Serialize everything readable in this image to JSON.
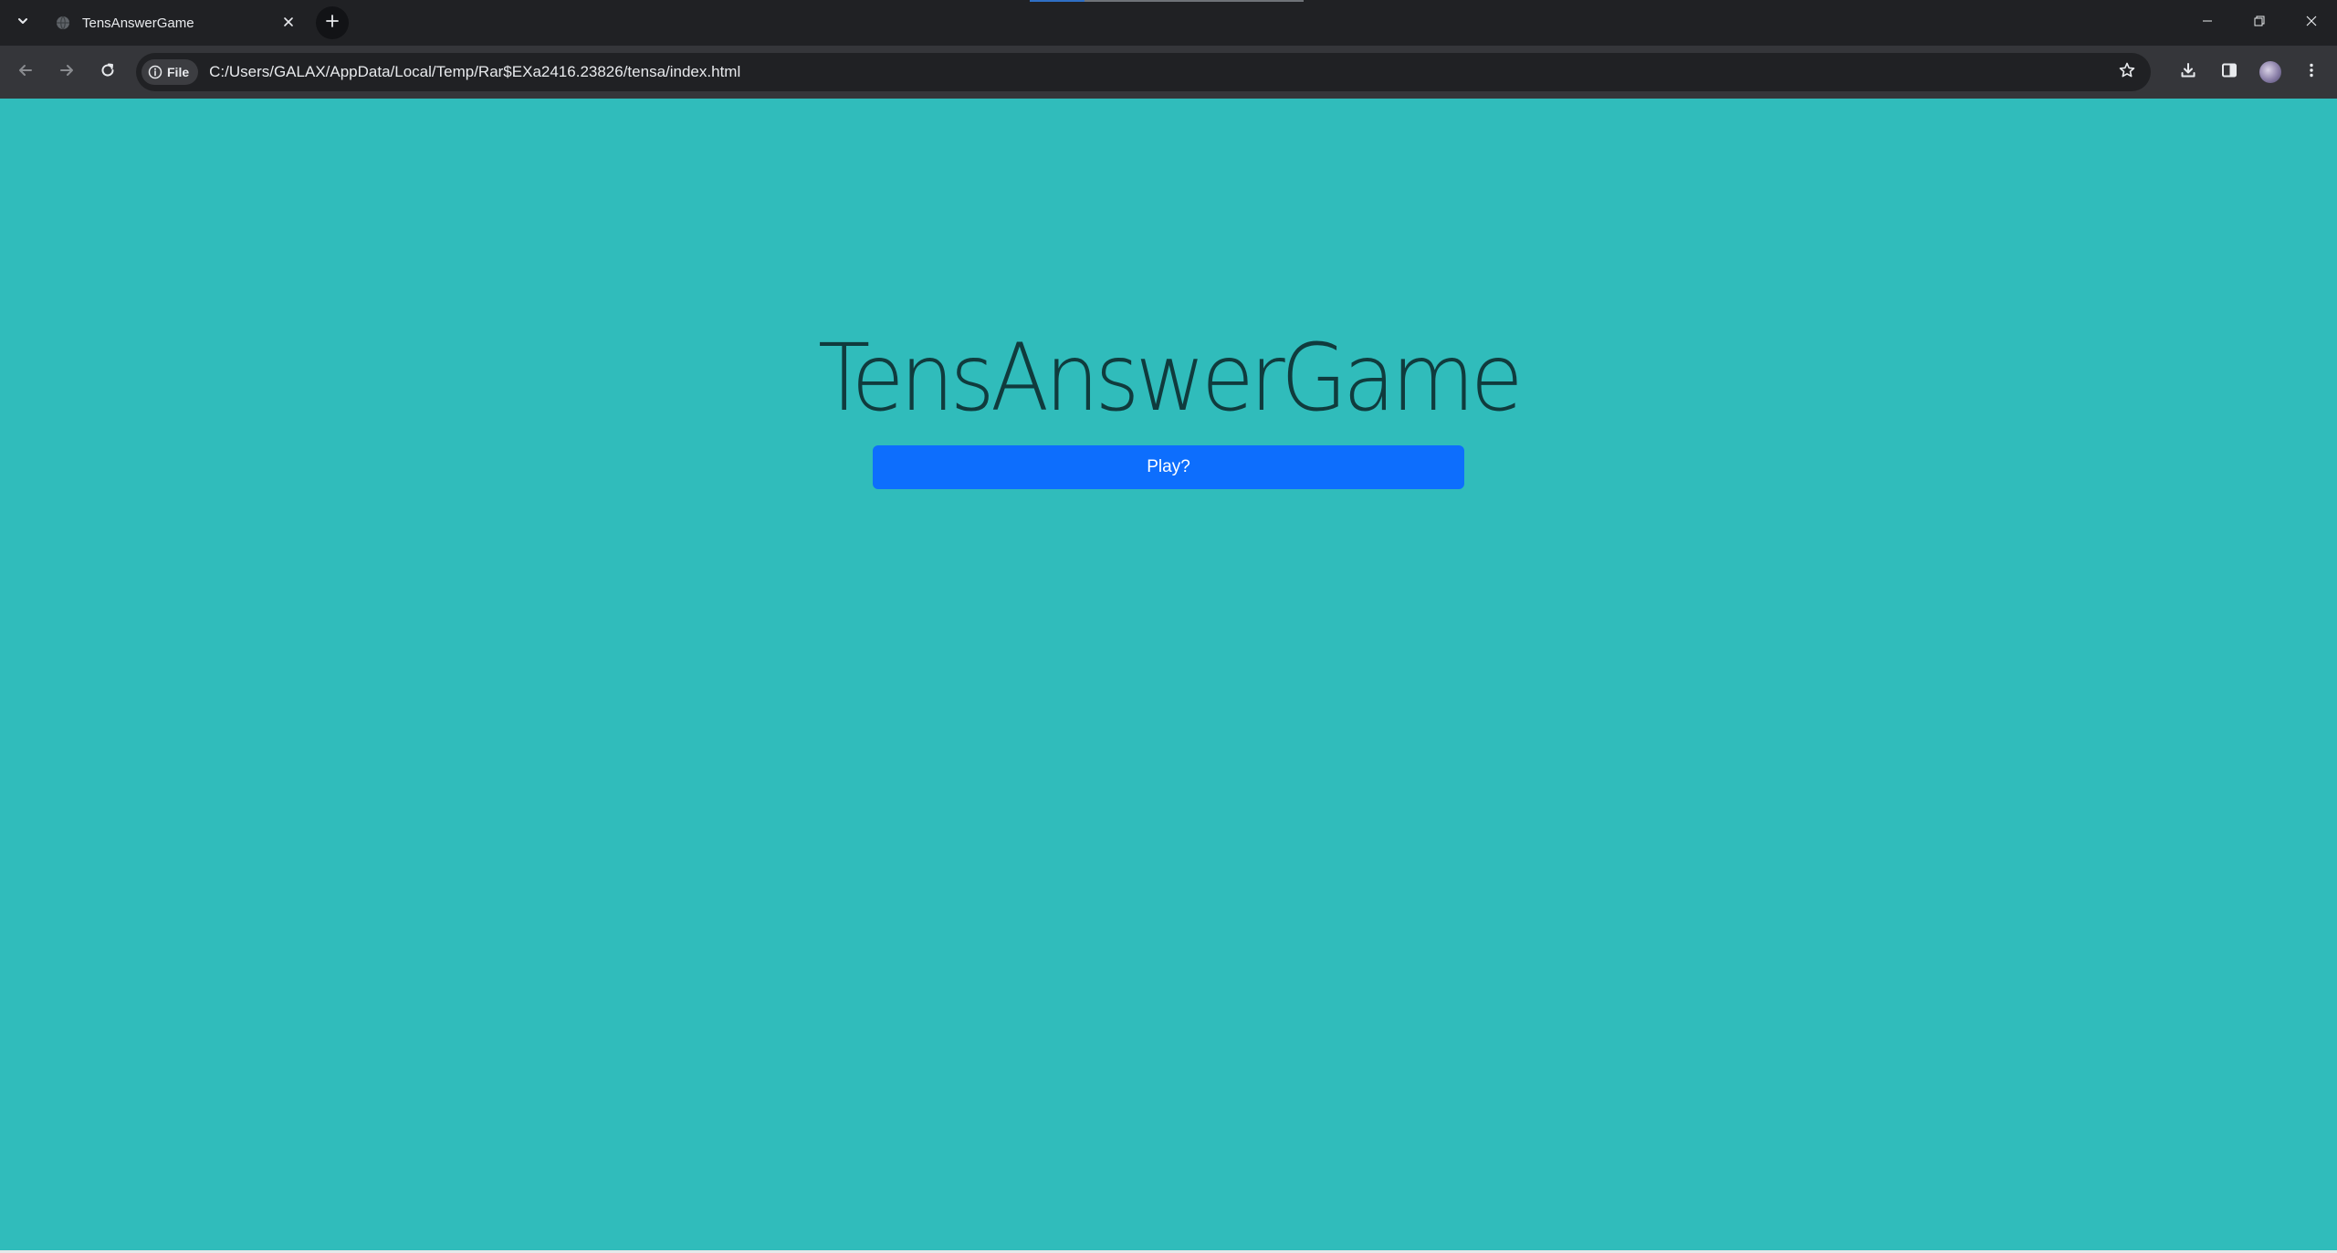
{
  "browser": {
    "tab": {
      "title": "TensAnswerGame"
    },
    "toolbar": {
      "chip_label": "File",
      "url": "C:/Users/GALAX/AppData/Local/Temp/Rar$EXa2416.23826/tensa/index.html"
    },
    "icons": {
      "tab_search": "chevron-down-icon",
      "favicon": "globe-icon",
      "tab_close": "close-icon",
      "new_tab": "plus-icon",
      "minimize": "minimize-icon",
      "restore": "restore-icon",
      "close_window": "close-icon",
      "back": "arrow-left-icon",
      "forward": "arrow-right-icon",
      "reload": "reload-icon",
      "site_info": "info-icon",
      "bookmark": "star-icon",
      "downloads": "download-icon",
      "side_panel": "side-panel-icon",
      "profile": "avatar"
    }
  },
  "page": {
    "title": "TensAnswerGame",
    "play_button_label": "Play?",
    "colors": {
      "background": "#30bcbb",
      "button": "#0d6efd",
      "title_text": "#103b3d"
    }
  }
}
